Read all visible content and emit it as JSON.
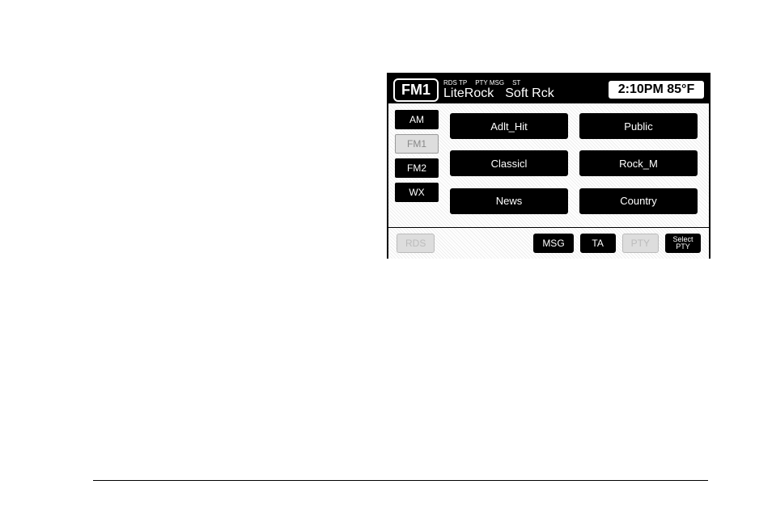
{
  "header": {
    "band": "FM1",
    "indicators": [
      "RDS TP",
      "PTY MSG",
      "ST"
    ],
    "station1": "LiteRock",
    "station2": "Soft Rck",
    "clock": "2:10PM 85°F"
  },
  "bands": {
    "am": "AM",
    "fm1": "FM1",
    "fm2": "FM2",
    "wx": "WX"
  },
  "presets": [
    "Adlt_Hit",
    "Public",
    "Classicl",
    "Rock_M",
    "News",
    "Country"
  ],
  "footer": {
    "rds": "RDS",
    "msg": "MSG",
    "ta": "TA",
    "pty": "PTY",
    "select_pty_line1": "Select",
    "select_pty_line2": "PTY"
  }
}
